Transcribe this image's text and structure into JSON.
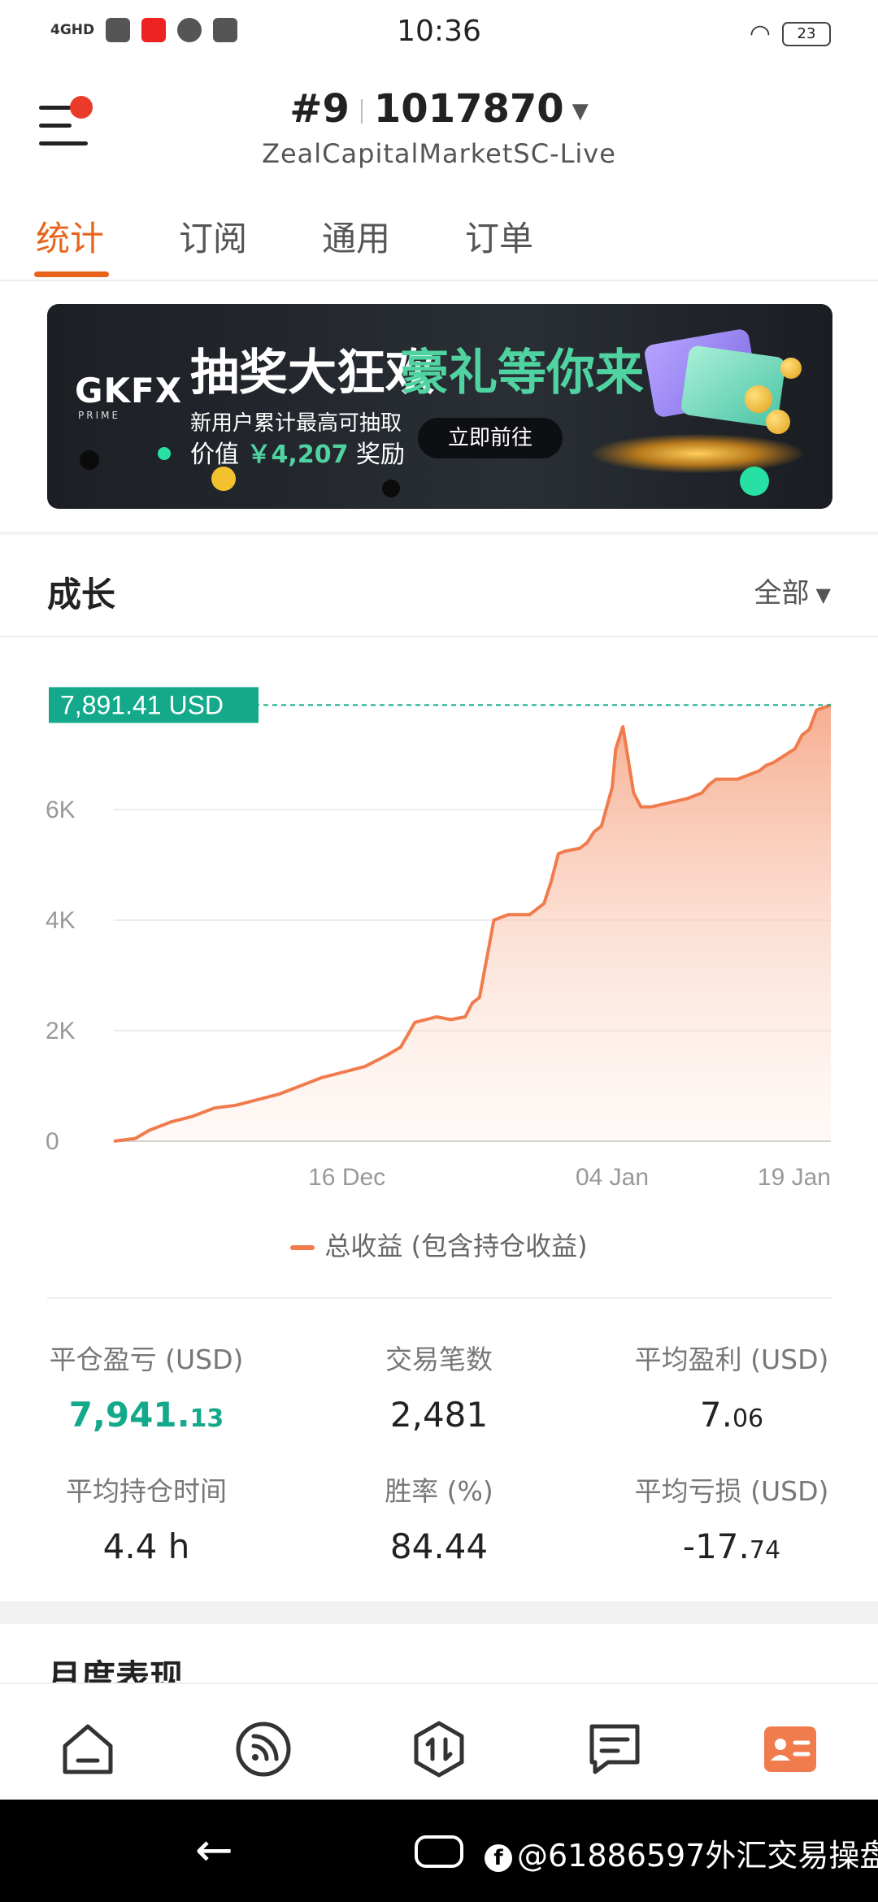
{
  "status_bar": {
    "network": "4GHD",
    "time": "10:36",
    "battery": "23"
  },
  "header": {
    "account_number": "#9",
    "account_id": "1017870",
    "server": "ZealCapitalMarketSC-Live"
  },
  "tabs": [
    {
      "label": "统计",
      "active": true
    },
    {
      "label": "订阅",
      "active": false
    },
    {
      "label": "通用",
      "active": false
    },
    {
      "label": "订单",
      "active": false
    }
  ],
  "banner": {
    "logo": "GKFX",
    "logo_sub": "PRIME",
    "headline_a": "抽奖大狂欢",
    "headline_b": "豪礼等你来",
    "line1": "新用户累计最高可抽取",
    "line2_prefix": "价值",
    "amount": "￥4,207",
    "line2_suffix": "奖励",
    "cta": "立即前往"
  },
  "growth": {
    "title": "成长",
    "filter": "全部"
  },
  "chart_data": {
    "type": "area",
    "current_label": "7,891.41 USD",
    "current_value": 7891.41,
    "y_ticks": [
      "0",
      "2K",
      "4K",
      "6K"
    ],
    "y_tick_values": [
      0,
      2000,
      4000,
      6000
    ],
    "ylim": [
      0,
      8000
    ],
    "x_ticks": [
      "16 Dec",
      "04 Jan",
      "19 Jan"
    ],
    "x_tick_positions": [
      0.325,
      0.695,
      1.0
    ],
    "series": [
      {
        "name": "总收益 (包含持仓收益)",
        "x": [
          0,
          0.03,
          0.05,
          0.08,
          0.11,
          0.14,
          0.17,
          0.2,
          0.23,
          0.26,
          0.29,
          0.32,
          0.35,
          0.38,
          0.4,
          0.42,
          0.45,
          0.47,
          0.49,
          0.5,
          0.51,
          0.53,
          0.55,
          0.58,
          0.6,
          0.61,
          0.62,
          0.63,
          0.65,
          0.66,
          0.67,
          0.68,
          0.695,
          0.7,
          0.71,
          0.725,
          0.735,
          0.74,
          0.745,
          0.75,
          0.8,
          0.82,
          0.83,
          0.84,
          0.87,
          0.89,
          0.9,
          0.91,
          0.92,
          0.95,
          0.96,
          0.97,
          0.98,
          1.0
        ],
        "values": [
          0,
          50,
          200,
          350,
          450,
          600,
          650,
          750,
          850,
          1000,
          1150,
          1250,
          1350,
          1550,
          1700,
          2150,
          2250,
          2200,
          2250,
          2500,
          2600,
          4000,
          4100,
          4100,
          4300,
          4700,
          5200,
          5250,
          5300,
          5400,
          5600,
          5700,
          6400,
          7100,
          7500,
          6300,
          6050,
          6050,
          6050,
          6050,
          6200,
          6300,
          6450,
          6550,
          6550,
          6650,
          6700,
          6800,
          6850,
          7100,
          7350,
          7450,
          7800,
          7891.41
        ]
      }
    ]
  },
  "stats": [
    {
      "label": "平仓盈亏 (USD)",
      "value_main": "7,941.",
      "value_frac": "13",
      "highlight": true
    },
    {
      "label": "交易笔数",
      "value_main": "2,481",
      "value_frac": "",
      "highlight": false
    },
    {
      "label": "平均盈利 (USD)",
      "value_main": "7.",
      "value_frac": "06",
      "highlight": false
    },
    {
      "label": "平均持仓时间",
      "value_main": "4.4 h",
      "value_frac": "",
      "highlight": false
    },
    {
      "label": "胜率 (%)",
      "value_main": "84.44",
      "value_frac": "",
      "highlight": false
    },
    {
      "label": "平均亏损 (USD)",
      "value_main": "-17.",
      "value_frac": "74",
      "highlight": false
    }
  ],
  "monthly_title": "月度表现",
  "bottom_nav": [
    {
      "name": "home",
      "icon": "home-icon"
    },
    {
      "name": "signals",
      "icon": "rss-icon"
    },
    {
      "name": "trade",
      "icon": "trade-icon"
    },
    {
      "name": "news",
      "icon": "chat-icon"
    },
    {
      "name": "profile",
      "icon": "profile-card-icon",
      "active": true
    }
  ],
  "watermark": "@61886597",
  "watermark_suffix": "外汇交易操盘手",
  "colors": {
    "accent": "#e8641c",
    "green": "#13a98a",
    "chart_line": "#f07b4c",
    "chart_fill": "#f6a98a",
    "notification": "#ea3a2a"
  }
}
